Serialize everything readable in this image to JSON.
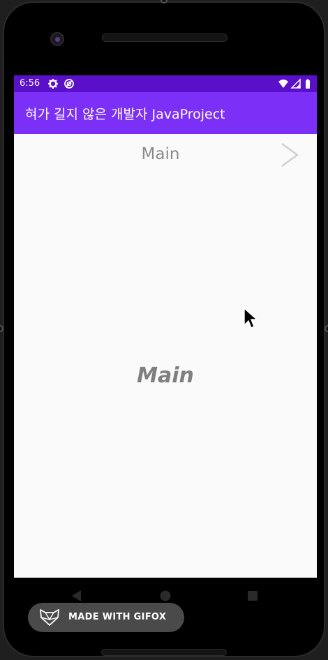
{
  "status_bar": {
    "time": "6:56",
    "icons": [
      "settings-icon",
      "sync-icon",
      "wifi-icon",
      "signal-icon",
      "battery-icon"
    ]
  },
  "app_bar": {
    "title": "혀가 길지 않은 개발자 JavaProject"
  },
  "content": {
    "header_title": "Main",
    "center_label": "Main",
    "next_icon": "chevron-right-icon"
  },
  "nav_bar": {
    "buttons": [
      "back-icon",
      "home-icon",
      "recents-icon"
    ]
  },
  "watermark": {
    "label": "MADE WITH GIFOX"
  },
  "colors": {
    "status_bar": "#5a0fc8",
    "app_bar": "#7b2ff7",
    "background": "#fafafa",
    "text_muted": "#8b8b8b"
  }
}
